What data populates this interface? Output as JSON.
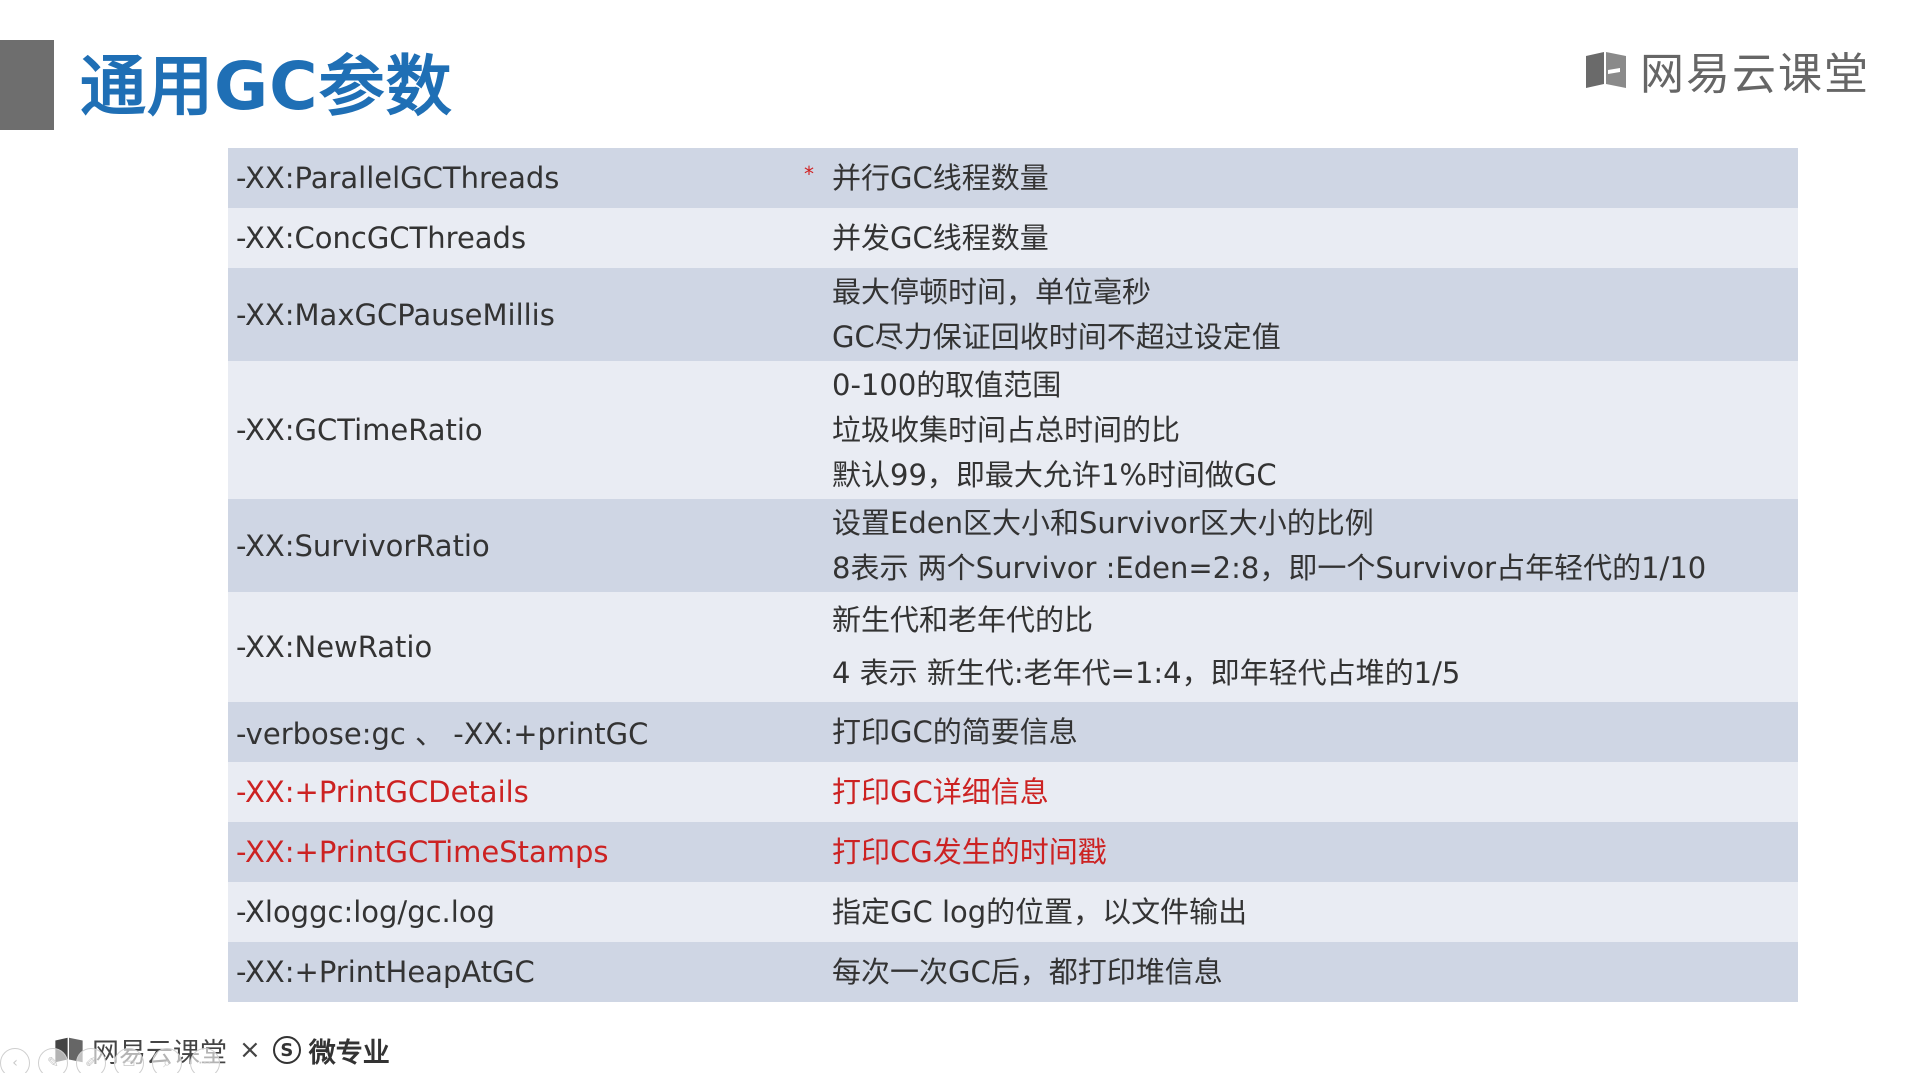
{
  "title": "通用GC参数",
  "brand": {
    "name": "网易云课堂",
    "icon": "book-icon"
  },
  "table": {
    "rows": [
      {
        "name": "-XX:ParallelGCThreads",
        "desc": [
          "并行GC线程数量"
        ],
        "marker": "*",
        "highlight": false
      },
      {
        "name": "-XX:ConcGCThreads",
        "desc": [
          "并发GC线程数量"
        ],
        "highlight": false
      },
      {
        "name": "-XX:MaxGCPauseMillis",
        "desc": [
          "最大停顿时间，单位毫秒",
          "GC尽力保证回收时间不超过设定值"
        ],
        "highlight": false
      },
      {
        "name": "-XX:GCTimeRatio",
        "desc": [
          "0-100的取值范围",
          "垃圾收集时间占总时间的比",
          "默认99，即最大允许1%时间做GC"
        ],
        "highlight": false
      },
      {
        "name": "-XX:SurvivorRatio",
        "desc": [
          "设置Eden区大小和Survivor区大小的比例",
          "8表示 两个Survivor :Eden=2:8，即一个Survivor占年轻代的1/10"
        ],
        "highlight": false
      },
      {
        "name": "-XX:NewRatio",
        "desc": [
          "新生代和老年代的比",
          "4 表示 新生代:老年代=1:4，即年轻代占堆的1/5"
        ],
        "highlight": false
      },
      {
        "name": "-verbose:gc 、 -XX:+printGC",
        "desc": [
          "打印GC的简要信息"
        ],
        "highlight": false
      },
      {
        "name": "-XX:+PrintGCDetails",
        "desc": [
          "打印GC详细信息"
        ],
        "highlight": true
      },
      {
        "name": "-XX:+PrintGCTimeStamps",
        "desc": [
          "打印CG发生的时间戳"
        ],
        "highlight": true
      },
      {
        "name": "-Xloggc:log/gc.log",
        "desc": [
          "指定GC log的位置，以文件输出"
        ],
        "highlight": false
      },
      {
        "name": "-XX:+PrintHeapAtGC",
        "desc": [
          "每次一次GC后，都打印堆信息"
        ],
        "highlight": false
      }
    ]
  },
  "footer": {
    "brand": "网易云课堂",
    "times": "×",
    "partner_logo": "S",
    "partner": "微专业"
  },
  "player_controls": [
    {
      "icon": "prev-icon"
    },
    {
      "icon": "pen-icon"
    },
    {
      "icon": "edit-icon"
    },
    {
      "icon": "slides-icon"
    },
    {
      "icon": "zoom-icon"
    },
    {
      "icon": "more-icon"
    }
  ],
  "colors": {
    "title": "#1f6fb5",
    "row_odd": "#cfd6e4",
    "row_even": "#e9ecf3",
    "highlight_text": "#cc2222",
    "accent_bar": "#6e6e6e"
  }
}
